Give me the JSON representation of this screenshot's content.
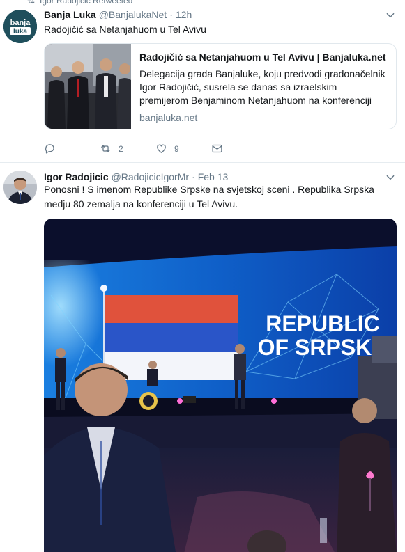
{
  "retweet_context": {
    "text": "Igor Radojicic Retweeted",
    "icon": "retweet-icon"
  },
  "tweets": [
    {
      "name": "Banja Luka",
      "handle": "@BanjalukaNet",
      "separator": "·",
      "time": "12h",
      "text": "Radojičić sa Netanjahuom u Tel Avivu",
      "avatar_logo": "banja luka",
      "card": {
        "title": "Radojičić sa Netanjahuom u Tel Avivu | Banjaluka.net",
        "description": "Delegacija grada Banjaluke, koju predvodi gradonačelnik Igor Radojičić, susrela se danas sa izraelskim premijerom Benjaminom Netanjahuom na konferenciji Muni-expo...",
        "domain": "banjaluka.net"
      },
      "actions": {
        "reply": "",
        "retweets": "2",
        "likes": "9"
      }
    },
    {
      "name": "Igor Radojicic",
      "handle": "@RadojicicIgorMr",
      "separator": "·",
      "time": "Feb 13",
      "text": "Ponosni ! S imenom Republike Srpske na svjetskoj sceni . Republika Srpska medju 80 zemalja na konferenciji u Tel Avivu.",
      "media": {
        "screen_line1": "REPUBLIC",
        "screen_line2": "OF SRPSKA"
      }
    }
  ],
  "colors": {
    "text": "#14171a",
    "secondary": "#657786",
    "border": "#e6ecf0",
    "avatar_bg": "#1f4f5c"
  }
}
